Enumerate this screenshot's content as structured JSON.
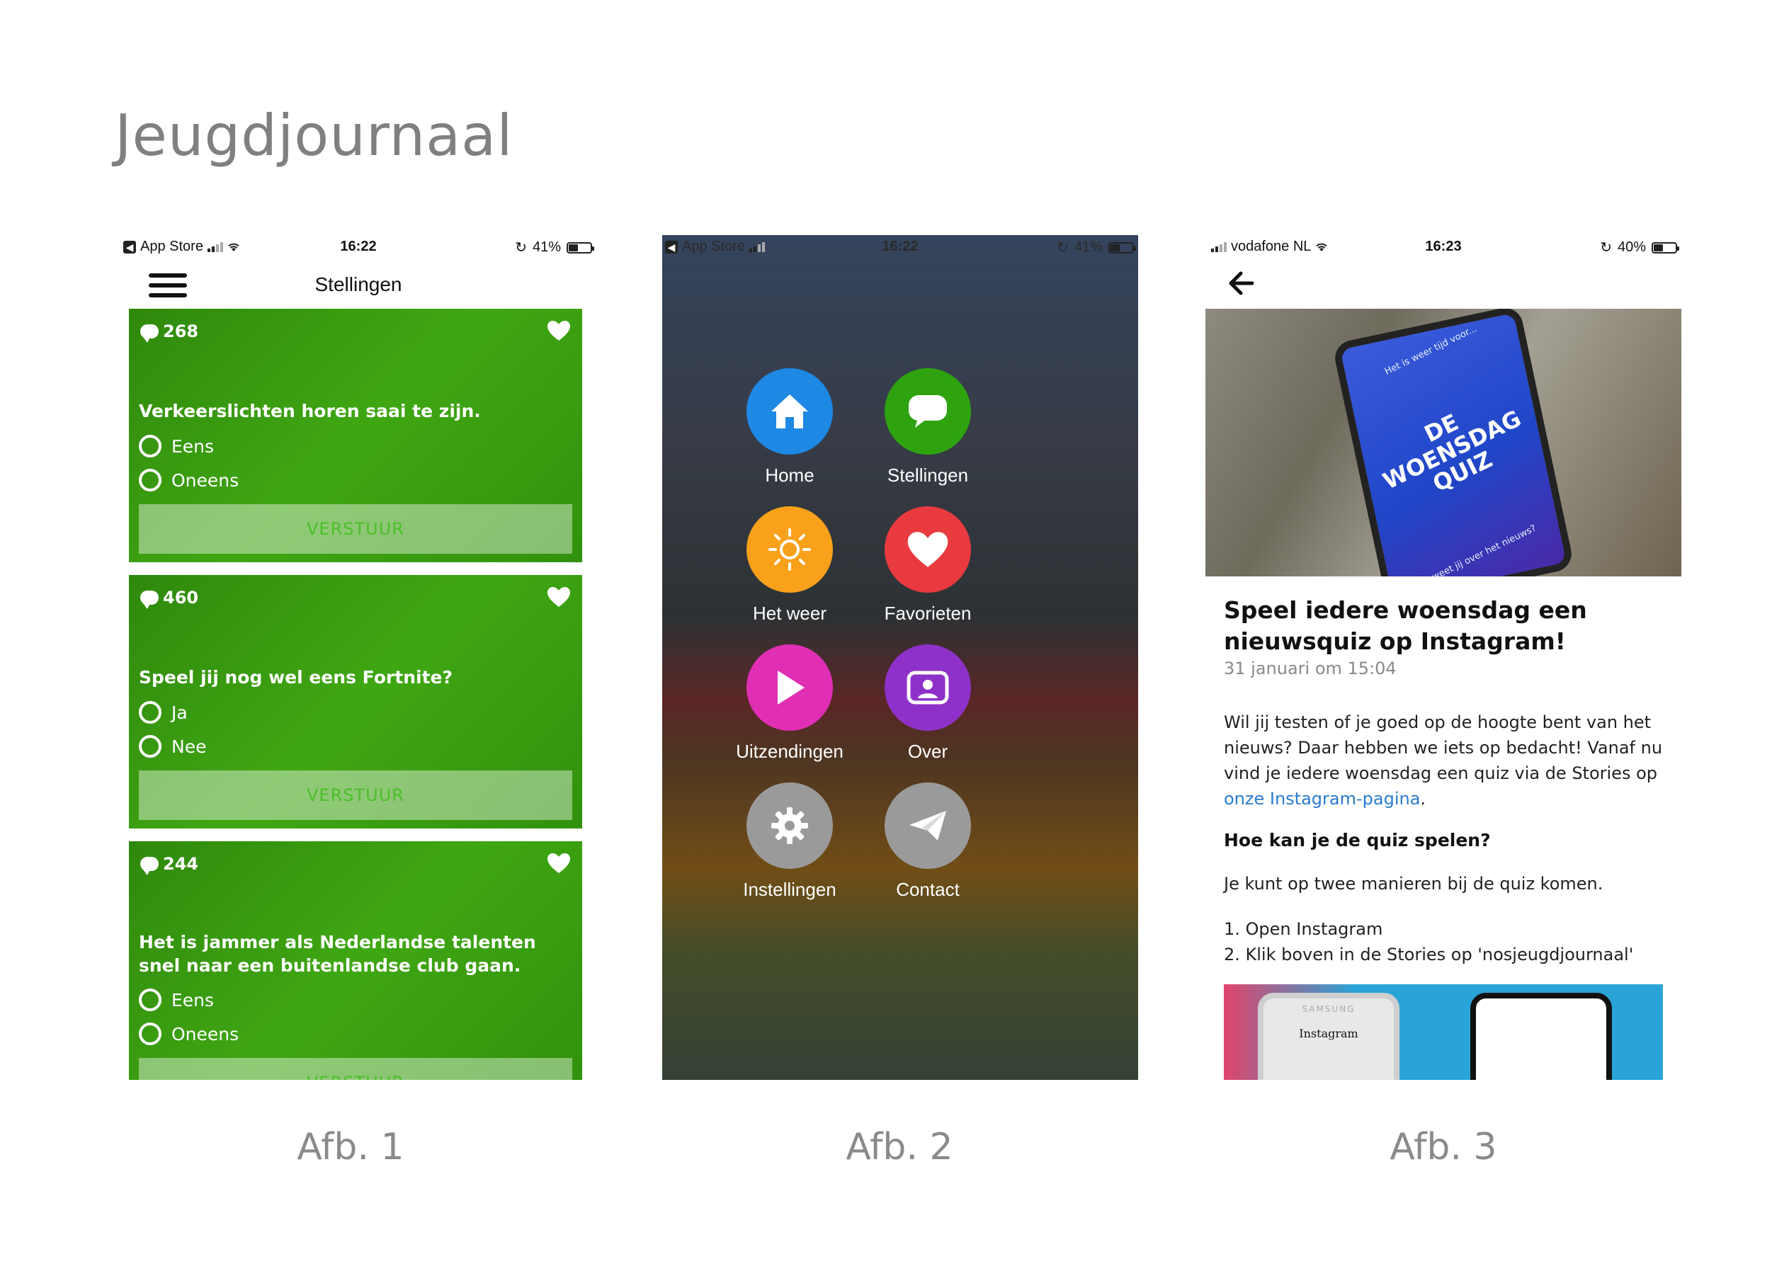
{
  "page": {
    "title": "Jeugdjournaal"
  },
  "captions": [
    "Afb. 1",
    "Afb. 2",
    "Afb. 3"
  ],
  "phone1": {
    "status": {
      "carrier": "App Store",
      "time": "16:22",
      "battery": "41%"
    },
    "nav_title": "Stellingen",
    "cards": [
      {
        "comments": "268",
        "question": "Verkeerslichten horen saai te zijn.",
        "options": [
          "Eens",
          "Oneens"
        ],
        "submit": "VERSTUUR"
      },
      {
        "comments": "460",
        "question": "Speel jij nog wel eens Fortnite?",
        "options": [
          "Ja",
          "Nee"
        ],
        "submit": "VERSTUUR"
      },
      {
        "comments": "244",
        "question": "Het is jammer als Nederlandse talenten snel naar een buitenlandse club gaan.",
        "options": [
          "Eens",
          "Oneens"
        ],
        "submit": "VERSTUUR"
      }
    ]
  },
  "phone2": {
    "status": {
      "carrier": "App Store",
      "time": "16:22",
      "battery": "41%"
    },
    "menu": [
      {
        "label": "Home",
        "icon": "home-icon",
        "color": "#1e88e5"
      },
      {
        "label": "Stellingen",
        "icon": "speech-bubble-icon",
        "color": "#2ea30f"
      },
      {
        "label": "Het weer",
        "icon": "sun-icon",
        "color": "#f9a11b"
      },
      {
        "label": "Favorieten",
        "icon": "heart-icon",
        "color": "#e93a3f"
      },
      {
        "label": "Uitzendingen",
        "icon": "play-icon",
        "color": "#e02fb4"
      },
      {
        "label": "Over",
        "icon": "profile-card-icon",
        "color": "#8e31c8"
      },
      {
        "label": "Instellingen",
        "icon": "gear-icon",
        "color": "#9a9a9a"
      },
      {
        "label": "Contact",
        "icon": "paper-plane-icon",
        "color": "#9a9a9a"
      }
    ]
  },
  "phone3": {
    "status": {
      "carrier": "vodafone NL",
      "time": "16:23",
      "battery": "40%"
    },
    "hero": {
      "line1": "Het is weer tijd voor...",
      "title": "DE WOENSDAG QUIZ",
      "line2": "Wat weet jij over het nieuws?"
    },
    "article": {
      "title": "Speel iedere woensdag een nieuwsquiz op Instagram!",
      "date": "31 januari om 15:04",
      "body": "Wil jij testen of je goed op de hoogte bent van het nieuws? Daar hebben we iets op bedacht! Vanaf nu vind je iedere woensdag een quiz via de Stories op ",
      "link": "onze Instagram-pagina",
      "body_end": ".",
      "subheading": "Hoe kan je de quiz spelen?",
      "p2": "Je kunt op twee manieren bij de quiz komen.",
      "steps": [
        "1. Open Instagram",
        "2. Klik boven in de Stories op 'nosjeugdjournaal'"
      ],
      "promo_label": "Instagram",
      "promo_brand": "SAMSUNG"
    }
  },
  "colors": {
    "card_green": "#3ba10f",
    "link_blue": "#2a7bd0"
  }
}
